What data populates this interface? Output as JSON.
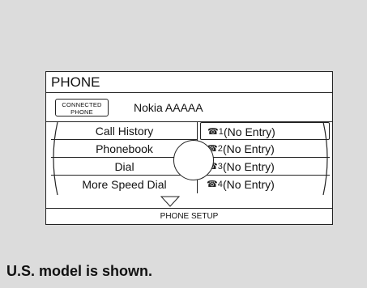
{
  "screen": {
    "title": "PHONE",
    "connected_badge": {
      "line1": "CONNECTED",
      "line2": "PHONE"
    },
    "phone_name": "Nokia AAAAA",
    "menu_items": [
      "Call History",
      "Phonebook",
      "Dial",
      "More Speed Dial"
    ],
    "speed_dial_entries": [
      {
        "icon": "speed-dial-1-icon",
        "label": "(No Entry)"
      },
      {
        "icon": "speed-dial-2-icon",
        "label": "(No Entry)"
      },
      {
        "icon": "speed-dial-3-icon",
        "label": "(No Entry)"
      },
      {
        "icon": "speed-dial-4-icon",
        "label": "(No Entry)"
      }
    ],
    "setup_label": "PHONE SETUP"
  },
  "caption": "U.S. model is shown."
}
